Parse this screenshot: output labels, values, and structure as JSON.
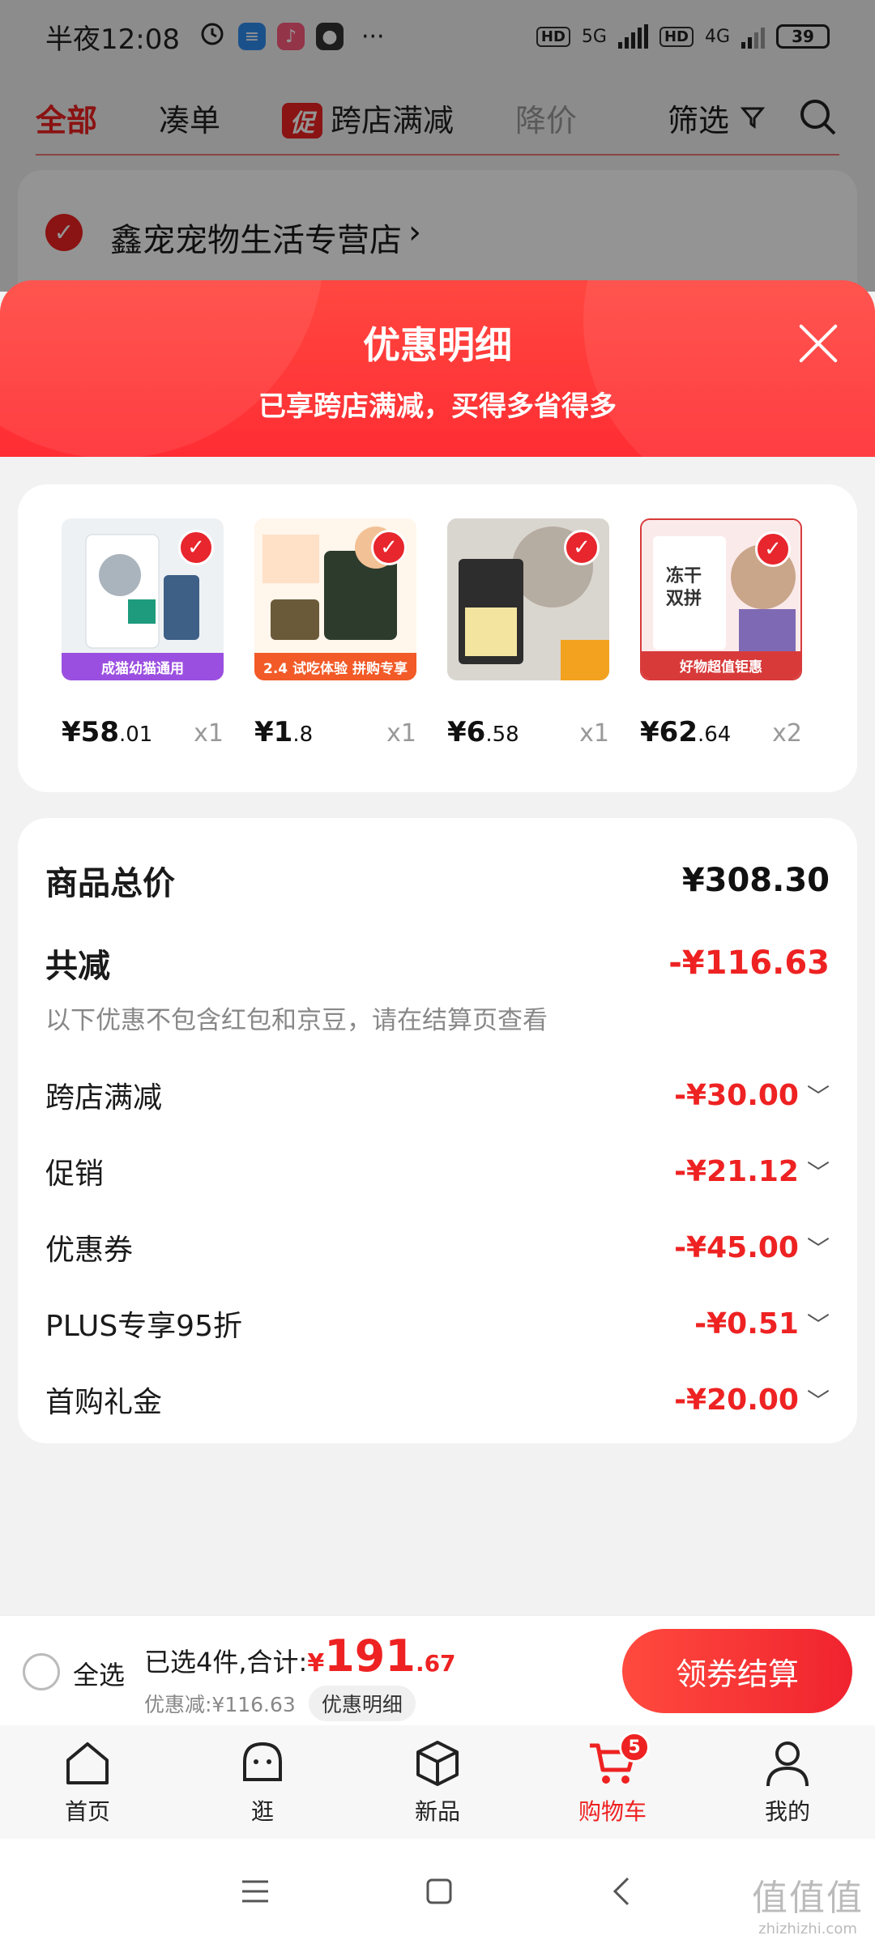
{
  "status_bar": {
    "time": "半夜12:08",
    "more": "···",
    "net1": "5G",
    "net2": "4G",
    "battery": "39"
  },
  "top_nav": {
    "tabs": [
      "全部",
      "凑单",
      "跨店满减",
      "降价",
      "筛选"
    ],
    "promo_badge": "促"
  },
  "store": {
    "name": "鑫宠宠物生活专营店",
    "chevron": "›"
  },
  "sheet": {
    "title": "优惠明细",
    "subtitle": "已享跨店满减，买得多省得多"
  },
  "products": [
    {
      "price_int": "¥58",
      "price_dec": ".01",
      "qty": "x1",
      "tag": "成猫幼猫通用",
      "bg": "#eef1f4",
      "tag_color": "#9b4fe0"
    },
    {
      "price_int": "¥1",
      "price_dec": ".8",
      "qty": "x1",
      "tag": "2.4 试吃体验 拼购专享",
      "bg": "#fdf4ee",
      "tag_color": "#f25a27"
    },
    {
      "price_int": "¥6",
      "price_dec": ".58",
      "qty": "x1",
      "tag": "",
      "bg": "#e9e6de",
      "tag_color": "#f2a21e"
    },
    {
      "price_int": "¥62",
      "price_dec": ".64",
      "qty": "x2",
      "tag": "好物超值钜惠",
      "bg": "#f6e6e6",
      "tag_color": "#d83a3a"
    }
  ],
  "summary": {
    "total_label": "商品总价",
    "total_value": "¥308.30",
    "reduce_label": "共减",
    "reduce_value": "-¥116.63",
    "note": "以下优惠不包含红包和京豆，请在结算页查看",
    "items": [
      {
        "label": "跨店满减",
        "value": "-¥30.00"
      },
      {
        "label": "促销",
        "value": "-¥21.12"
      },
      {
        "label": "优惠券",
        "value": "-¥45.00"
      },
      {
        "label": "PLUS专享95折",
        "value": "-¥0.51"
      },
      {
        "label": "首购礼金",
        "value": "-¥20.00"
      }
    ]
  },
  "checkout": {
    "select_all": "全选",
    "selected": "已选4件,合计:",
    "total_cur": "¥",
    "total_int": "191",
    "total_dec": ".67",
    "discount": "优惠减:¥116.63",
    "detail": "优惠明细",
    "pay_button": "领券结算"
  },
  "tabbar": {
    "items": [
      "首页",
      "逛",
      "新品",
      "购物车",
      "我的"
    ],
    "cart_badge": "5"
  },
  "watermark": {
    "big": "值值值",
    "small": "zhizhizhi.com"
  },
  "colors": {
    "accent": "#e22222",
    "header_red": "#ff2d33"
  }
}
